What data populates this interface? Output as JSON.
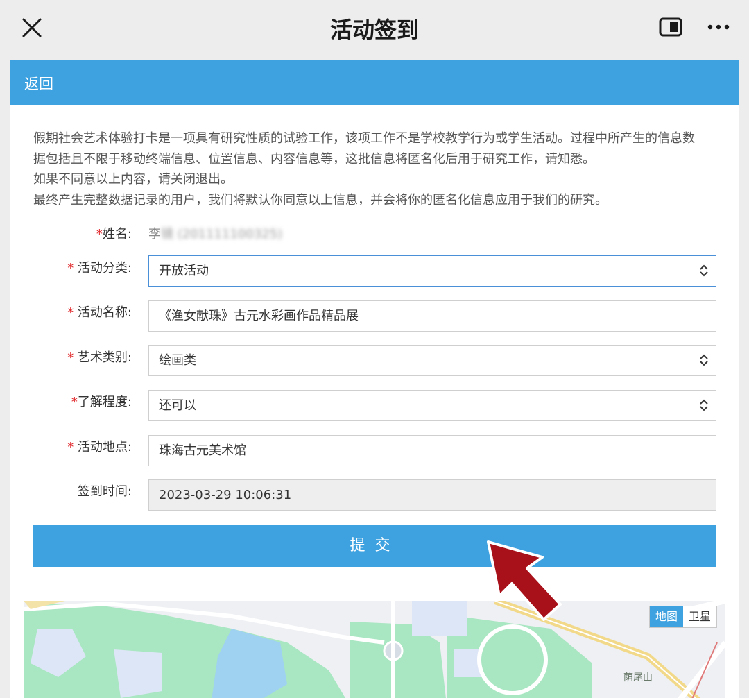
{
  "topbar": {
    "title": "活动签到",
    "icons": [
      "close-icon",
      "minimize-window-icon",
      "more-icon"
    ]
  },
  "header": {
    "back_label": "返回"
  },
  "notice": {
    "lines": [
      "假期社会艺术体验打卡是一项具有研究性质的试验工作，该项工作不是学校教学行为或学生活动。过程中所产生的信息数",
      "据包括且不限于移动终端信息、位置信息、内容信息等，这批信息将匿名化后用于研究工作，请知悉。",
      "如果不同意以上内容，请关闭退出。",
      "最终产生完整数据记录的用户，我们将默认你同意以上信息，并会将你的匿名化信息应用于我们的研究。"
    ]
  },
  "form": {
    "name": {
      "star": "*",
      "label": "姓名:",
      "value": "李",
      "value_blurred": "镜 (201111100325)"
    },
    "category": {
      "star": "* ",
      "label": "活动分类:",
      "value": "开放活动"
    },
    "activity_name": {
      "star": "* ",
      "label": "活动名称:",
      "value": "《渔女献珠》古元水彩画作品精品展"
    },
    "art_type": {
      "star": "* ",
      "label": "艺术类别:",
      "value": "绘画类"
    },
    "understanding": {
      "star": "*",
      "label": "了解程度:",
      "value": "还可以"
    },
    "location": {
      "star": "* ",
      "label": "活动地点:",
      "value": "珠海古元美术馆"
    },
    "checkin_time": {
      "label": "签到时间:",
      "value": "2023-03-29 10:06:31"
    }
  },
  "submit_label": "提交",
  "map": {
    "toggle_map": "地图",
    "toggle_satellite": "卫星",
    "place_label": "荫尾山"
  },
  "colors": {
    "accent": "#3fa2e0",
    "required_star": "#e0262a",
    "arrow": "#a8101a"
  }
}
